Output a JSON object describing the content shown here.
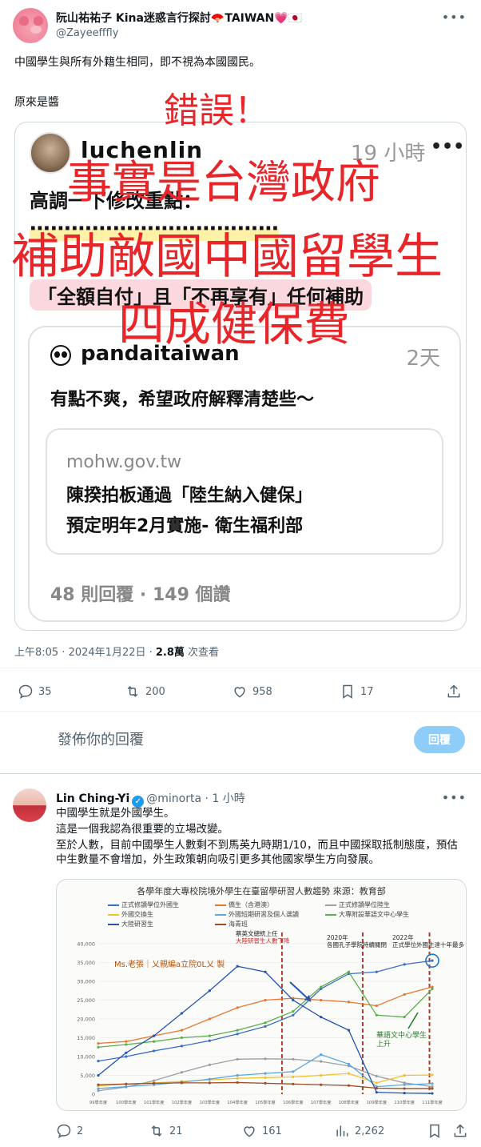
{
  "tweet1": {
    "name": "阮山祐祐子 Kina迷惑言行探討🪭TAIWAN💗🇯🇵",
    "handle": "@Zayeefffly",
    "text1": "中國學生與所有外籍生相同，即不視為本國國民。",
    "text2": "原來是醬",
    "meta_time": "上午8:05 · 2024年1月22日 · ",
    "meta_views": "2.8萬",
    "meta_views_label": " 次查看",
    "actions": {
      "reply": "35",
      "retweet": "200",
      "like": "958",
      "bookmark": "17"
    },
    "reply_placeholder": "發佈你的回覆",
    "reply_button": "回覆"
  },
  "quoted_image": {
    "user": "luchenlin",
    "time": "19 小時",
    "line1": "高調一下修改重點：",
    "line2": "⋯⋯⋯⋯⋯⋯⋯⋯⋯⋯⋯⋯",
    "line3": "「全額自付」且「不再享有」任何補助",
    "inner": {
      "user": "pandaitaiwan",
      "time": "2天",
      "text": "有點不爽，希望政府解釋清楚些～",
      "link_domain": "mohw.gov.tw",
      "link_title1": "陳揆拍板通過「陸生納入健保」",
      "link_title2": "預定明年2月實施- 衛生福利部",
      "stats": "48 則回覆 · 149 個讚"
    }
  },
  "overlay": {
    "line1": "錯誤！",
    "line2": "事實是台灣政府",
    "line3": "補助敵國中國留學生",
    "line4": "四成健保費"
  },
  "tweet2": {
    "name": "Lin Ching-Yi",
    "handle": "@minorta · 1 小時",
    "line1": "中國學生就是外國學生。",
    "line2": "這是一個我認為很重要的立場改變。",
    "line3": "至於人數，目前中國學生人數剩不到馬英九時期1/10，而且中國採取抵制態度，預估中生數量不會增加，外生政策朝向吸引更多其他國家學生方向發展。",
    "actions": {
      "reply": "2",
      "retweet": "21",
      "like": "161",
      "views": "2,262"
    }
  },
  "chart_data": {
    "type": "line",
    "title": "各學年度大專校院境外學生在臺留學研習人數趨勢  來源：教育部",
    "x": [
      "99學年度",
      "100學年度",
      "101學年度",
      "102學年度",
      "103學年度",
      "104學年度",
      "105學年度",
      "106學年度",
      "107學年度",
      "108學年度",
      "109學年度",
      "110學年度",
      "111學年度"
    ],
    "ylim": [
      0,
      40000
    ],
    "yticks": [
      "0",
      "5,000",
      "10,000",
      "15,000",
      "20,000",
      "25,000",
      "30,000",
      "35,000",
      "40,000"
    ],
    "series": [
      {
        "name": "正式修讀學位外國生",
        "color": "#3b6fc6",
        "values": [
          8800,
          10000,
          11500,
          12800,
          14200,
          16000,
          18000,
          21000,
          28000,
          32000,
          32500,
          34500,
          35500
        ]
      },
      {
        "name": "僑生（含港澳）",
        "color": "#e8772e",
        "values": [
          13500,
          14000,
          15500,
          17000,
          20000,
          23000,
          25000,
          25500,
          25000,
          24500,
          23500,
          26500,
          28500
        ]
      },
      {
        "name": "正式修讀學位陸生",
        "color": "#9aa0a6",
        "values": [
          900,
          1900,
          3600,
          5800,
          7800,
          9300,
          9400,
          9300,
          8700,
          7500,
          4800,
          3000,
          2000
        ]
      },
      {
        "name": "外國交換生",
        "color": "#f2c230",
        "values": [
          2200,
          2700,
          3000,
          3400,
          3800,
          4200,
          4400,
          4600,
          5000,
          5500,
          3000,
          5000,
          5100
        ]
      },
      {
        "name": "外國短期研習及個人選讀",
        "color": "#5aa7e0",
        "values": [
          1500,
          2000,
          2500,
          3200,
          4000,
          5000,
          5500,
          6000,
          10500,
          8000,
          2000,
          2500,
          2800
        ]
      },
      {
        "name": "大專附設華語文中心學生",
        "color": "#5cae4e",
        "values": [
          12500,
          13200,
          14000,
          15000,
          15500,
          17000,
          19000,
          22000,
          28500,
          32500,
          21000,
          20500,
          28000
        ]
      },
      {
        "name": "大陸研習生",
        "color": "#2456b0",
        "values": [
          5000,
          11000,
          15500,
          21500,
          27500,
          34000,
          32500,
          25000,
          20500,
          17000,
          500,
          300,
          200
        ]
      },
      {
        "name": "海青班",
        "color": "#9b4d2a",
        "values": [
          2500,
          2700,
          2900,
          3000,
          3000,
          3100,
          2900,
          2700,
          2500,
          2300,
          1600,
          1500,
          1500
        ]
      }
    ],
    "annotations": {
      "a1_l1": "蔡英文總統上任",
      "a1_l2": "大陸研習生人數下降",
      "a2_l1": "2020年",
      "a2_l2": "各國孔子學院持續關閉",
      "a3_l1": "2022年",
      "a3_l2": "正式學位外國生達十年最多",
      "green_l1": "華語文中心學生",
      "green_l2": "上升",
      "ms": "Ms.老張｜乂親編a立院0L乂 製"
    }
  }
}
